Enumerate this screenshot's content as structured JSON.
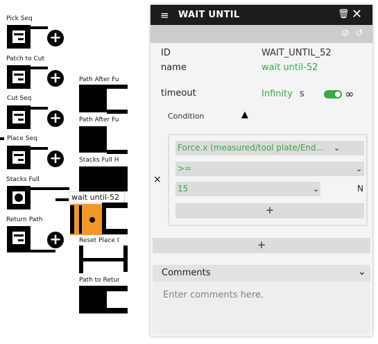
{
  "tree": {
    "nodes": [
      {
        "label": "Pick Seq",
        "icon": "sequence-icon"
      },
      {
        "label": "Patch to Cut",
        "icon": "sequence-icon"
      },
      {
        "label": "Cut Seq",
        "icon": "sequence-icon"
      },
      {
        "label": "Place Seq",
        "icon": "sequence-icon"
      },
      {
        "label": "Stacks Full",
        "icon": "dot-icon"
      },
      {
        "label": "Return Path",
        "icon": "sequence-icon"
      }
    ],
    "children": [
      {
        "label": "Path After Fu"
      },
      {
        "label": "Path After Fu"
      },
      {
        "label": "Stacks Full H"
      },
      {
        "label": "Reset Place C"
      },
      {
        "label": "Path to Retur"
      }
    ],
    "selected_tag": "wait until-52",
    "plus_glyph": "+"
  },
  "panel": {
    "header": {
      "icon": "function-icon",
      "title": "WAIT UNTIL",
      "trash_icon": "trash-icon",
      "close_icon": "close-icon"
    },
    "toolbar": {
      "disable_icon": "disable-icon",
      "reset_icon": "reset-icon"
    },
    "id_label": "ID",
    "id_value": "WAIT_UNTIL_52",
    "name_label": "name",
    "name_value": "wait until-52",
    "timeout_label": "timeout",
    "timeout_value": "Infinity",
    "timeout_unit": "s",
    "timeout_toggle_on": true,
    "infinity_symbol": "∞",
    "condition": {
      "label": "Condition",
      "remove_symbol": "×",
      "signal": "Force.x (measured/tool plate/End...",
      "operator": ">=",
      "value": "15",
      "unit": "N",
      "add_symbol": "+"
    },
    "add_condition_symbol": "+",
    "comments": {
      "label": "Comments",
      "placeholder": "Enter comments here."
    }
  },
  "colors": {
    "accent_green": "#3aa845",
    "selected_orange": "#f0982a",
    "header_bg": "#1c1c1c"
  }
}
